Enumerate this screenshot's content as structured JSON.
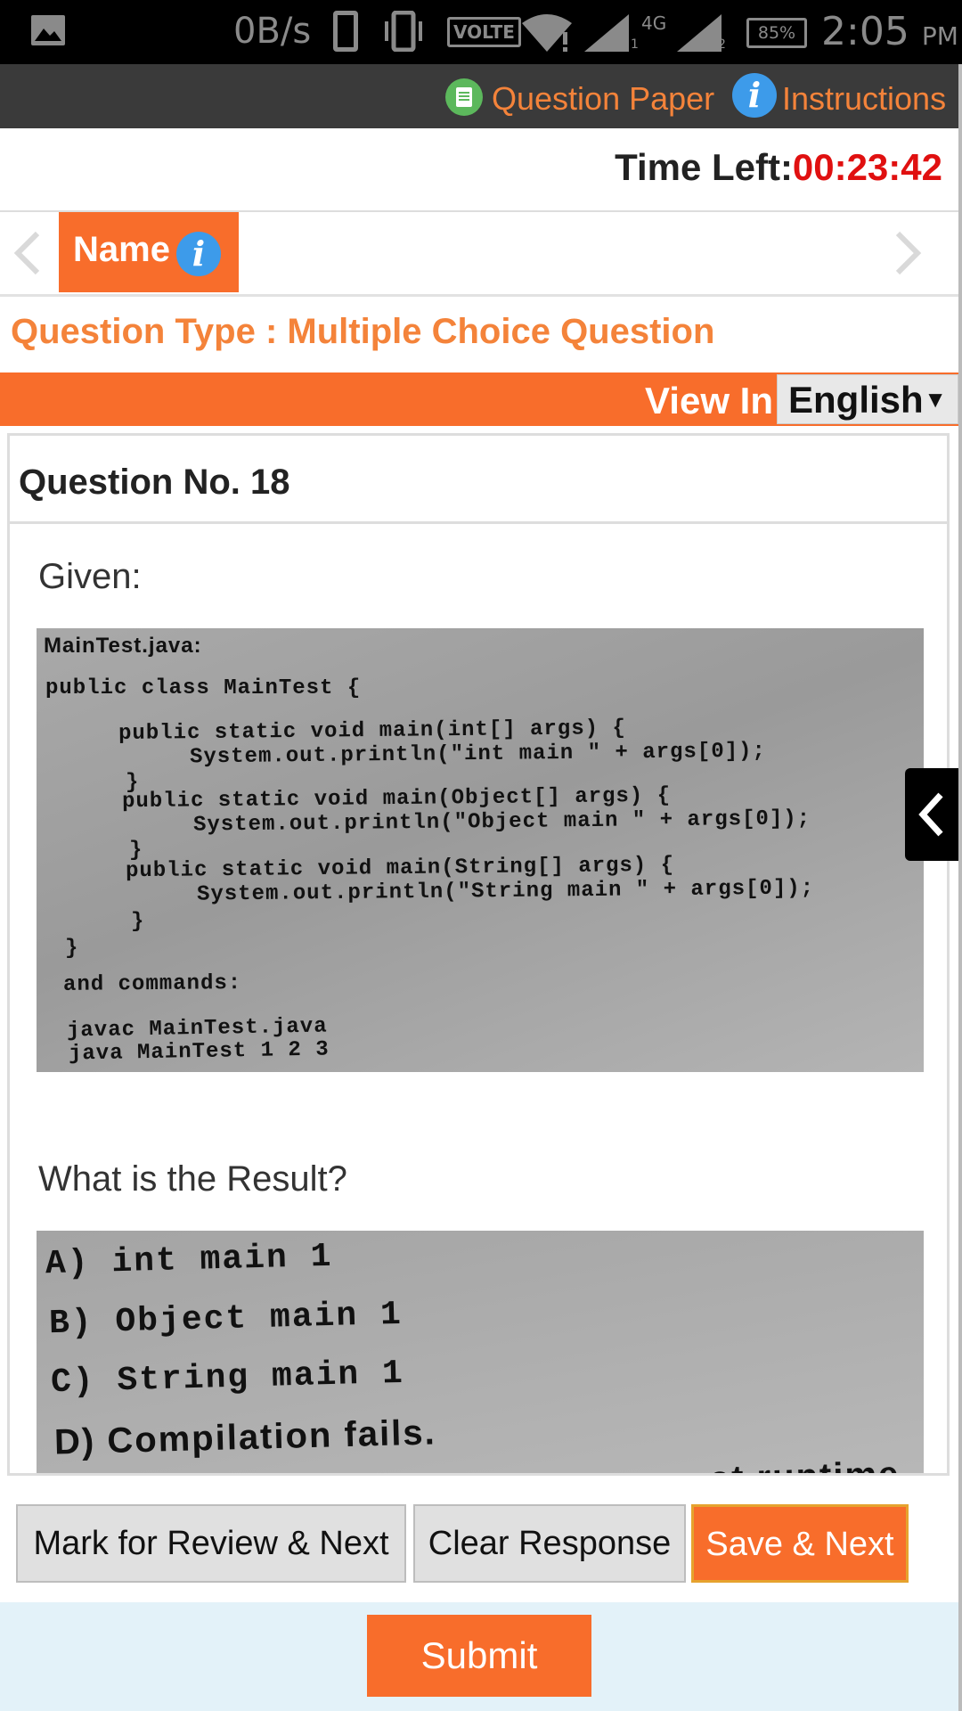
{
  "status_bar": {
    "net_speed": "0B/s",
    "volte": "VOLTE",
    "sim1_label": "1",
    "network_type": "4G",
    "sim2_label": "2",
    "battery": "85%",
    "time": "2:05",
    "ampm": "PM"
  },
  "top_nav": {
    "question_paper_label": "Question Paper",
    "instructions_label": "Instructions"
  },
  "timer": {
    "label": "Time Left:",
    "value": "00:23:42",
    "value_color": "#e01010"
  },
  "section_tabs": {
    "active": "Name",
    "info_icon": "i"
  },
  "question_type": "Question Type : Multiple Choice Question",
  "view_in": {
    "label": "View In",
    "language": "English",
    "caret": "▼"
  },
  "question": {
    "number_label": "Question No. 18",
    "given": "Given:",
    "code_lines": [
      "MainTest.java:",
      "public class MainTest {",
      "public static void main(int[] args) {",
      "System.out.println(\"int main \" + args[0]);",
      "}",
      "public static void main(Object[] args) {",
      "System.out.println(\"Object main \" + args[0]);",
      "}",
      "public static void main(String[] args) {",
      "System.out.println(\"String main \" + args[0]);",
      "}",
      "}",
      "and commands:",
      "javac MainTest.java",
      "java MainTest 1 2 3"
    ],
    "prompt": "What is the Result?",
    "options": [
      "A) int main 1",
      "B) Object main 1",
      "C) String main 1",
      "D) Compilation fails.",
      "at runtime."
    ]
  },
  "actions": {
    "mark_review": "Mark for Review & Next",
    "clear": "Clear Response",
    "save_next": "Save & Next",
    "submit": "Submit"
  },
  "colors": {
    "accent": "#f86d2b",
    "accent_text": "#f4833a",
    "info_blue": "#3d9bea",
    "nav_bg": "#3a3a3a",
    "submit_bg": "#e3f2f9"
  }
}
